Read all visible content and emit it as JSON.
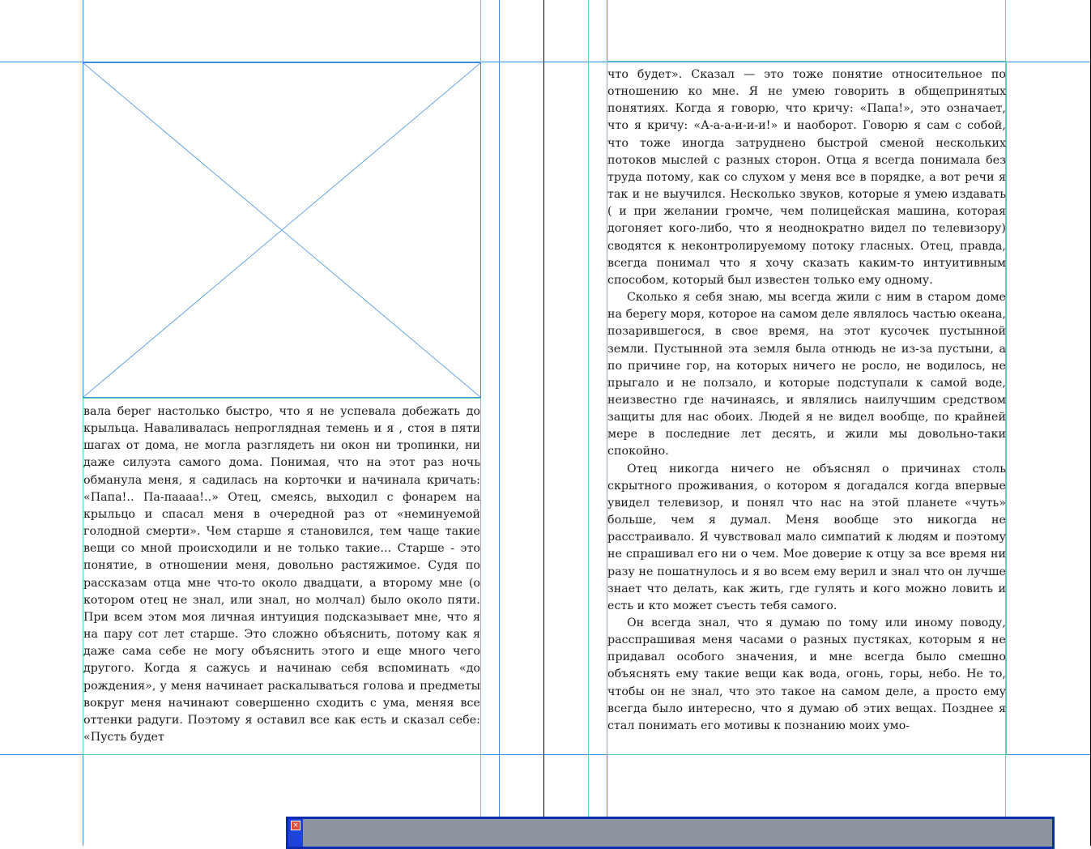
{
  "app": {
    "canvas_background": "#ffffff",
    "guide_color_blue": "#3c8fe0",
    "guide_color_teal": "#5fd1b4"
  },
  "left_page": {
    "placeholder_icon": "image-placeholder-cross-icon",
    "paragraphs": [
      "вала берег настолько быстро, что я не успевала добежать до крыльца. Наваливалась непроглядная темень и я , стоя в пяти шагах от дома, не могла разглядеть ни окон ни тропинки, ни даже силуэта самого дома. Понимая, что на этот раз ночь обманула меня, я садилась на корточки и начинала кричать: «Папа!.. Па-паааа!..» Отец, смеясь, выходил с фонарем на крыльцо и спасал меня в очередной раз от «неминуемой голодной смерти». Чем старше я становился, тем чаще такие вещи со мной происходили и не только такие... Старше - это понятие, в отношении меня, довольно растяжимое. Судя по рассказам отца мне что-то около двадцати, а второму мне (о котором отец не знал, или знал, но молчал) было около пяти. При всем этом моя личная интуиция подсказывает мне, что я на пару сот лет старше. Это сложно объяснить, потому как я даже сама себе не могу объяснить этого и еще много чего другого. Когда я сажусь и начинаю себя вспоминать «до рождения», у меня начинает раскалываться голова и предметы вокруг меня начинают совершенно сходить с ума, меняя все оттенки радуги. Поэтому я оставил все как есть и сказал себе: «Пусть будет"
    ]
  },
  "right_page": {
    "paragraphs": [
      "что будет». Сказал — это тоже понятие относительное по отношению ко мне. Я не умею говорить в общепринятых понятиях. Когда я говорю, что кричу: «Папа!», это означает, что я кричу: «А-а-а-и-и-и!» и наоборот. Говорю я сам с собой, что тоже иногда затруднено быстрой сменой нескольких потоков мыслей с разных сторон. Отца я всегда понимала без труда потому, как со слухом у меня все в порядке, а вот речи я так и не выучился. Несколько звуков, которые я умею издавать ( и при желании громче, чем полицейская машина, которая догоняет кого-либо, что я неоднократно видел по телевизору) сводятся к неконтролируемому потоку гласных. Отец, правда, всегда понимал что я хочу сказать каким-то интуитивным способом, который был известен только ему одному.",
      "Сколько я себя знаю, мы всегда жили с ним в старом доме на берегу моря, которое на самом деле являлось частью океана, позарившегося, в свое время, на этот кусочек пустынной земли. Пустынной эта земля была отнюдь не из-за пустыни, а по причине гор, на которых ничего не росло, не водилось, не прыгало и не ползало, и которые подступали к самой воде, неизвестно где начинаясь, и являлись наилучшим средством защиты для нас обоих. Людей я не видел вообще, по крайней мере в последние лет десять, и жили мы довольно-таки спокойно.",
      "Отец никогда ничего не объяснял о причинах столь скрытного проживания, о котором я догадался когда впервые увидел телевизор, и понял что нас на этой планете «чуть» больше, чем я думал. Меня вообще это никогда не расстраивало. Я чувствовал мало симпатий к людям и поэтому не спрашивал его ни о чем. Мое доверие к отцу за все время ни разу не пошатнулось и я во всем ему верил и знал что он лучше знает что делать, как жить, где гулять и кого можно ловить и есть и кто может съесть тебя самого.",
      "Он всегда знал, что я думаю по тому или иному поводу, расспрашивая меня часами о разных пустяках, которым я не придавал особого значения, и мне всегда было смешно объяснять ему такие вещи как вода, огонь, горы, небо. Не то, чтобы он не знал, что это такое на самом деле, а просто ему всегда было интересно, что я думаю об этих вещах. Позднее я стал понимать его мотивы к познанию моих умо-"
    ]
  },
  "dialog": {
    "close_icon": "close-icon",
    "close_glyph": "×",
    "panel_color": "#8e949f",
    "border_color": "#0b2bb0"
  }
}
